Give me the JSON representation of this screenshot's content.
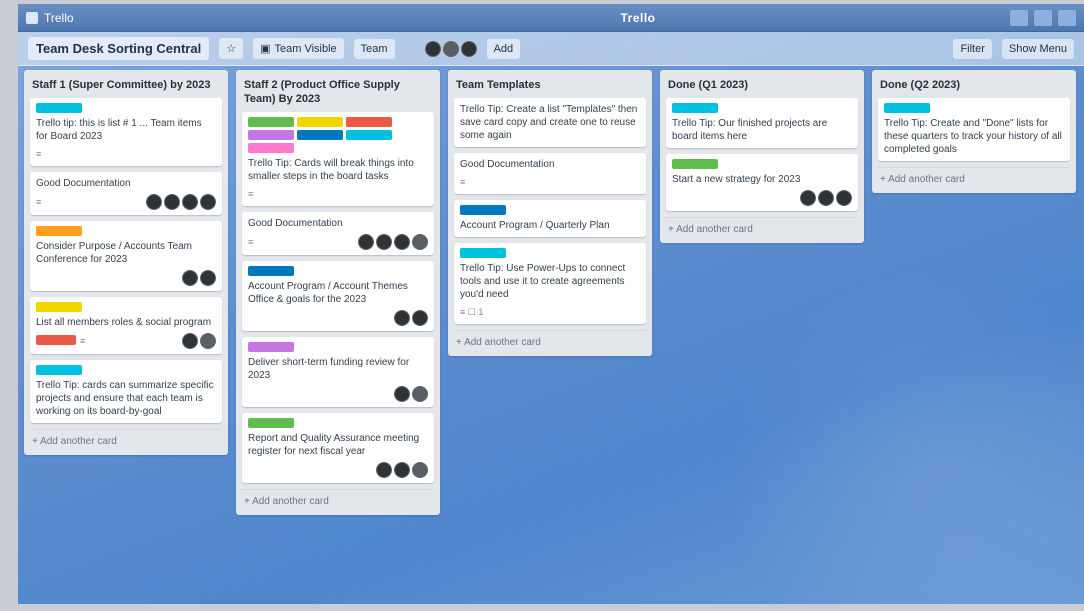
{
  "window": {
    "app_title": "Trello",
    "window_title": "Trello"
  },
  "board": {
    "title": "Team Desk Sorting Central",
    "visibility": "Team Visible",
    "org": "Team",
    "filter_label": "Filter",
    "menu_label": "Show Menu",
    "add_label": "Add"
  },
  "lists": [
    {
      "title": "Staff 1 (Super Committee) by 2023",
      "cards": [
        {
          "labels": [
            {
              "color": "#00c2e0"
            }
          ],
          "text": "Trello tip: this is list # 1 ... Team items for Board 2023",
          "badge": "≡",
          "avatars": []
        },
        {
          "labels": [],
          "text": "Good Documentation",
          "badge": "≡",
          "avatars": [
            "a",
            "a",
            "a",
            "a"
          ]
        },
        {
          "labels": [
            {
              "color": "#ff9f1a"
            }
          ],
          "text": "Consider Purpose / Accounts Team Conference for 2023",
          "badge": "",
          "avatars": [
            "a",
            "a"
          ]
        },
        {
          "labels": [
            {
              "color": "#f2d600"
            }
          ],
          "text": "List all members roles & social program",
          "badge": "≡",
          "avatars": [
            "a",
            "b"
          ],
          "extra_label": "#eb5a46"
        },
        {
          "labels": [
            {
              "color": "#00c2e0"
            }
          ],
          "text": "Trello Tip: cards can summarize specific projects and ensure that each team is working on its board-by-goal",
          "badge": "",
          "avatars": []
        }
      ],
      "add": "+ Add another card"
    },
    {
      "title": "Staff 2 (Product Office Supply Team) By 2023",
      "cards": [
        {
          "labels": [
            {
              "color": "#61bd4f"
            },
            {
              "color": "#f2d600"
            },
            {
              "color": "#eb5a46"
            },
            {
              "color": "#c377e0"
            },
            {
              "color": "#0079bf"
            },
            {
              "color": "#00c2e0"
            },
            {
              "color": "#ff78cb"
            }
          ],
          "text": "Trello Tip: Cards will break things into smaller steps in the board tasks",
          "badge": "≡",
          "avatars": []
        },
        {
          "labels": [],
          "text": "Good Documentation",
          "badge": "≡",
          "avatars": [
            "a",
            "a",
            "a",
            "b"
          ]
        },
        {
          "labels": [
            {
              "color": "#0079bf"
            }
          ],
          "text": "Account Program / Account Themes Office & goals for the 2023",
          "badge": "",
          "avatars": [
            "a",
            "a"
          ]
        },
        {
          "labels": [
            {
              "color": "#c377e0"
            }
          ],
          "text": "Deliver short-term funding review for 2023",
          "badge": "",
          "avatars": [
            "a",
            "b"
          ]
        },
        {
          "labels": [
            {
              "color": "#61bd4f"
            }
          ],
          "text": "Report and Quality Assurance meeting register for next fiscal year",
          "badge": "",
          "avatars": [
            "a",
            "a",
            "b"
          ]
        }
      ],
      "add": "+ Add another card"
    },
    {
      "title": "Team Templates",
      "cards": [
        {
          "labels": [],
          "text": "Trello Tip: Create a list \"Templates\" then save card copy and create one to reuse some again",
          "badge": "",
          "avatars": []
        },
        {
          "labels": [],
          "text": "Good Documentation",
          "badge": "≡",
          "avatars": []
        },
        {
          "labels": [
            {
              "color": "#0079bf"
            }
          ],
          "text": "Account Program / Quarterly Plan",
          "badge": "",
          "avatars": []
        },
        {
          "labels": [
            {
              "color": "#00c2e0"
            }
          ],
          "text": "Trello Tip: Use Power-Ups to connect tools and use it to create agreements you'd need",
          "badge": "≡ ☐ 1",
          "avatars": []
        }
      ],
      "add": "+ Add another card"
    },
    {
      "title": "Done (Q1 2023)",
      "cards": [
        {
          "labels": [
            {
              "color": "#00c2e0"
            }
          ],
          "text": "Trello Tip: Our finished projects are board items here",
          "badge": "",
          "avatars": []
        },
        {
          "labels": [
            {
              "color": "#61bd4f"
            }
          ],
          "text": "Start a new strategy for 2023",
          "badge": "",
          "avatars": [
            "a",
            "a",
            "a"
          ]
        }
      ],
      "add": "+ Add another card"
    },
    {
      "title": "Done (Q2 2023)",
      "cards": [
        {
          "labels": [
            {
              "color": "#00c2e0"
            }
          ],
          "text": "Trello Tip: Create and \"Done\" lists for these quarters to track your history of all completed goals",
          "badge": "",
          "avatars": []
        }
      ],
      "add": "+ Add another card"
    }
  ]
}
